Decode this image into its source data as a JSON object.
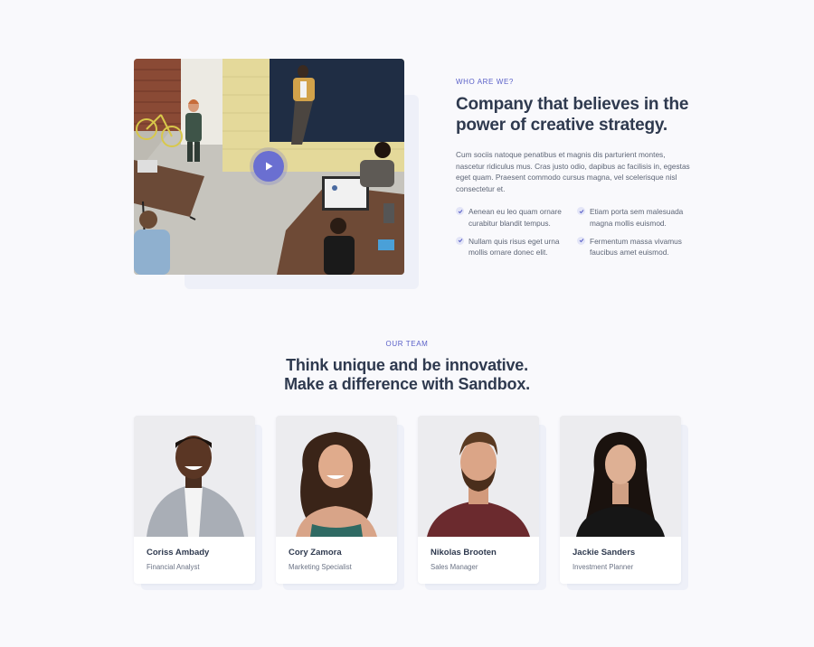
{
  "about": {
    "eyebrow": "WHO ARE WE?",
    "title_line1": "Company that believes in the",
    "title_line2": "power of creative strategy.",
    "body": "Cum sociis natoque penatibus et magnis dis parturient montes, nascetur ridiculus mus. Cras justo odio, dapibus ac facilisis in, egestas eget quam. Praesent commodo cursus magna, vel scelerisque nisl consectetur et.",
    "bullets": [
      "Aenean eu leo quam ornare curabitur blandit tempus.",
      "Etiam porta sem malesuada magna mollis euismod.",
      "Nullam quis risus eget urna mollis ornare donec elit.",
      "Fermentum massa vivamus faucibus amet euismod."
    ],
    "play_icon": "play-icon",
    "check_icon": "check-icon"
  },
  "team": {
    "eyebrow": "OUR TEAM",
    "title_line1": "Think unique and be innovative.",
    "title_line2": "Make a difference with Sandbox.",
    "members": [
      {
        "name": "Coriss Ambady",
        "role": "Financial Analyst"
      },
      {
        "name": "Cory Zamora",
        "role": "Marketing Specialist"
      },
      {
        "name": "Nikolas Brooten",
        "role": "Sales Manager"
      },
      {
        "name": "Jackie Sanders",
        "role": "Investment Planner"
      }
    ]
  },
  "colors": {
    "accent": "#5a60c8",
    "play": "#6a6fd1",
    "heading": "#2f3a4f",
    "page_bg": "#f9f9fc"
  }
}
